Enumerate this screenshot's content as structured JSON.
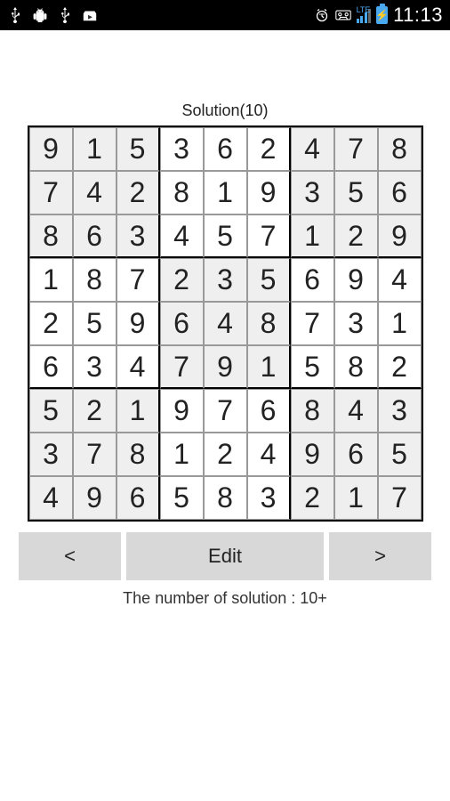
{
  "statusBar": {
    "clock": "11:13",
    "lte": "LTE"
  },
  "title": "Solution(10)",
  "grid": [
    [
      9,
      1,
      5,
      3,
      6,
      2,
      4,
      7,
      8
    ],
    [
      7,
      4,
      2,
      8,
      1,
      9,
      3,
      5,
      6
    ],
    [
      8,
      6,
      3,
      4,
      5,
      7,
      1,
      2,
      9
    ],
    [
      1,
      8,
      7,
      2,
      3,
      5,
      6,
      9,
      4
    ],
    [
      2,
      5,
      9,
      6,
      4,
      8,
      7,
      3,
      1
    ],
    [
      6,
      3,
      4,
      7,
      9,
      1,
      5,
      8,
      2
    ],
    [
      5,
      2,
      1,
      9,
      7,
      6,
      8,
      4,
      3
    ],
    [
      3,
      7,
      8,
      1,
      2,
      4,
      9,
      6,
      5
    ],
    [
      4,
      9,
      6,
      5,
      8,
      3,
      2,
      1,
      7
    ]
  ],
  "buttons": {
    "prev": "<",
    "edit": "Edit",
    "next": ">"
  },
  "footer": "The number of solution : 10+"
}
